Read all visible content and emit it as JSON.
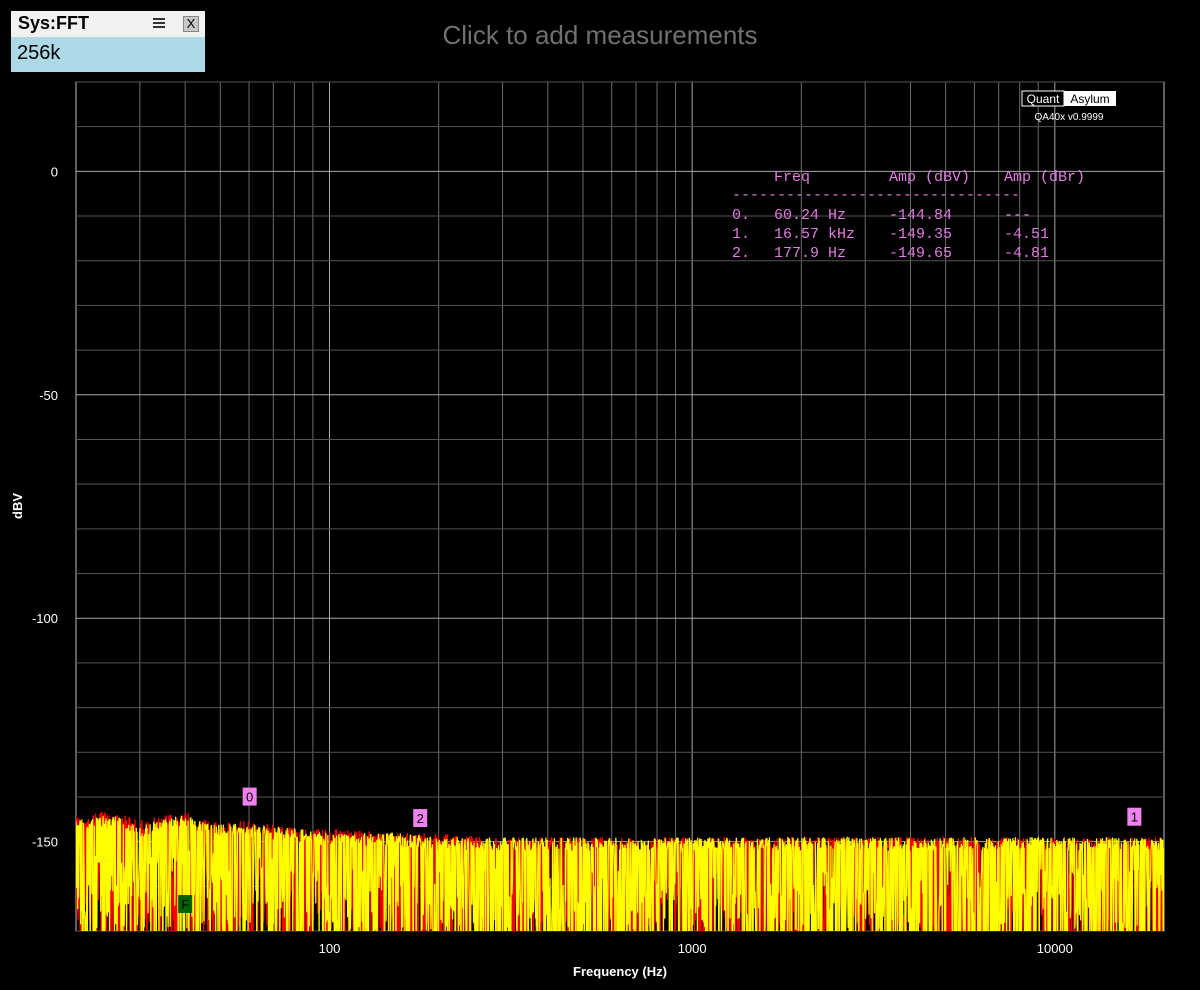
{
  "widget": {
    "title": "Sys:FFT",
    "value": "256k",
    "close_label": "X"
  },
  "header": {
    "add_measurements": "Click to add measurements"
  },
  "logo": {
    "part1": "Quant",
    "part2": "Asylum",
    "version": "QA40x v0.9999"
  },
  "measurements": {
    "header_freq": "Freq",
    "header_amp_dbv": "Amp (dBV)",
    "header_amp_dbr": "Amp (dBr)",
    "separator": "--------------------------------",
    "rows": [
      {
        "idx": "0.",
        "freq": "60.24 Hz",
        "amp": "-144.84",
        "dbr": "---"
      },
      {
        "idx": "1.",
        "freq": "16.57 kHz",
        "amp": "-149.35",
        "dbr": "-4.51"
      },
      {
        "idx": "2.",
        "freq": "177.9 Hz",
        "amp": "-149.65",
        "dbr": "-4.81"
      }
    ]
  },
  "chart_data": {
    "type": "line",
    "xlabel": "Frequency (Hz)",
    "ylabel": "dBV",
    "x_scale": "log",
    "xlim": [
      20,
      20000
    ],
    "ylim": [
      -170,
      20
    ],
    "xticks": [
      100,
      1000,
      10000
    ],
    "xtick_labels": [
      "100",
      "1000",
      "10000"
    ],
    "yticks": [
      0,
      -50,
      -100,
      -150
    ],
    "ytick_labels": [
      "0",
      "-50",
      "-100",
      "-150"
    ],
    "grid": true,
    "background": "#000000",
    "series": [
      {
        "color": "#ff0000",
        "x": [
          20,
          25,
          30,
          40,
          50,
          60,
          80,
          100,
          150,
          200,
          300,
          500,
          1000,
          2000,
          5000,
          10000,
          20000
        ],
        "y": [
          -147,
          -146,
          -148,
          -146,
          -149,
          -148,
          -150,
          -150,
          -151,
          -151,
          -152,
          -152,
          -152,
          -152,
          -152,
          -152,
          -152
        ]
      },
      {
        "color": "#ffff00",
        "x": [
          20,
          25,
          30,
          40,
          50,
          60,
          80,
          100,
          150,
          200,
          300,
          500,
          1000,
          2000,
          5000,
          10000,
          20000
        ],
        "y": [
          -148,
          -147,
          -149,
          -147,
          -149,
          -149,
          -150,
          -151,
          -151,
          -152,
          -152,
          -152,
          -152,
          -152,
          -152,
          -152,
          -152
        ]
      }
    ],
    "markers": [
      {
        "label": "0",
        "freq": 60.24,
        "amp": -144.84
      },
      {
        "label": "1",
        "freq": 16570,
        "amp": -149.35
      },
      {
        "label": "2",
        "freq": 177.9,
        "amp": -149.65
      }
    ],
    "f_marker": {
      "label": "F",
      "freq": 40,
      "color": "#006400"
    }
  }
}
